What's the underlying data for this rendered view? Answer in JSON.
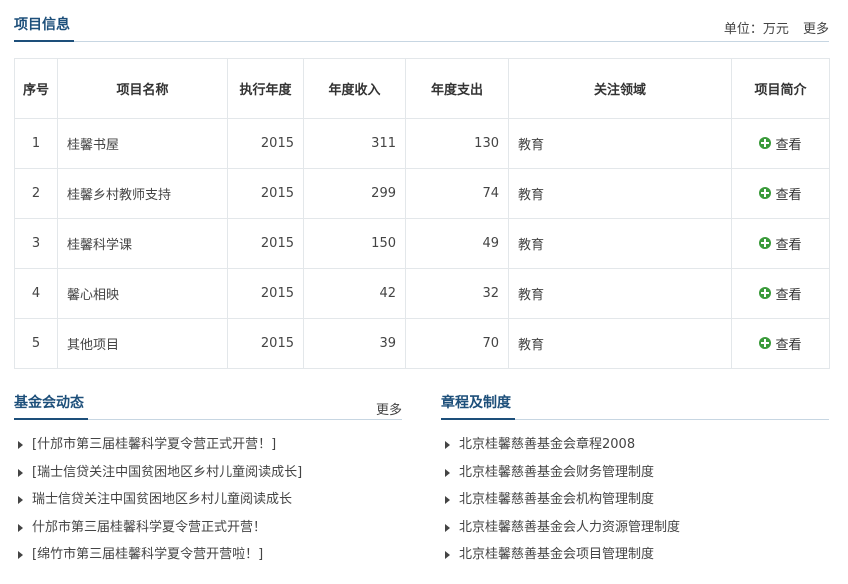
{
  "project_info": {
    "title": "项目信息",
    "unit": "单位：万元",
    "more": "更多",
    "columns": [
      "序号",
      "项目名称",
      "执行年度",
      "年度收入",
      "年度支出",
      "关注领域",
      "项目简介"
    ],
    "rows": [
      {
        "no": "1",
        "name": "桂馨书屋",
        "year": "2015",
        "income": "311",
        "expense": "130",
        "field": "教育",
        "action": "查看"
      },
      {
        "no": "2",
        "name": "桂馨乡村教师支持",
        "year": "2015",
        "income": "299",
        "expense": "74",
        "field": "教育",
        "action": "查看"
      },
      {
        "no": "3",
        "name": "桂馨科学课",
        "year": "2015",
        "income": "150",
        "expense": "49",
        "field": "教育",
        "action": "查看"
      },
      {
        "no": "4",
        "name": "馨心相映",
        "year": "2015",
        "income": "42",
        "expense": "32",
        "field": "教育",
        "action": "查看"
      },
      {
        "no": "5",
        "name": "其他项目",
        "year": "2015",
        "income": "39",
        "expense": "70",
        "field": "教育",
        "action": "查看"
      }
    ]
  },
  "news": {
    "title": "基金会动态",
    "more": "更多",
    "items": [
      "[什邡市第三届桂馨科学夏令营正式开营！]",
      "[瑞士信贷关注中国贫困地区乡村儿童阅读成长]",
      "瑞士信贷关注中国贫困地区乡村儿童阅读成长",
      "什邡市第三届桂馨科学夏令营正式开营！",
      "[绵竹市第三届桂馨科学夏令营开营啦！]"
    ]
  },
  "rules": {
    "title": "章程及制度",
    "items": [
      "北京桂馨慈善基金会章程2008",
      "北京桂馨慈善基金会财务管理制度",
      "北京桂馨慈善基金会机构管理制度",
      "北京桂馨慈善基金会人力资源管理制度",
      "北京桂馨慈善基金会项目管理制度"
    ]
  }
}
